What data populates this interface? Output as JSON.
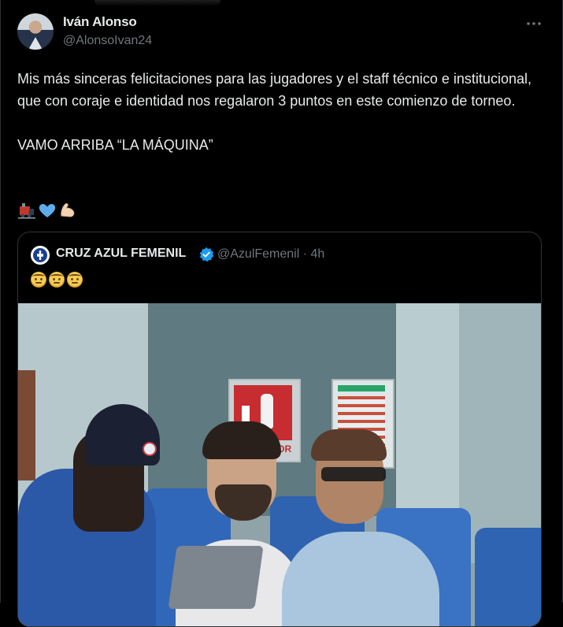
{
  "author": {
    "display_name": "Iván Alonso",
    "handle": "@AlonsoIvan24"
  },
  "tweet": {
    "text": "Mis más sinceras felicitaciones para las jugadores y el staff técnico e institucional, que con coraje e identidad nos regalaron 3 puntos en este comienzo de torneo.\n\nVAMO ARRIBA “LA MÁQUINA”",
    "emojis": [
      "train-icon",
      "blue-heart-icon",
      "flexed-biceps-icon"
    ]
  },
  "quote": {
    "display_name": "CRUZ AZUL FEMENIL",
    "handle_time": "@AzulFemenil · 4h",
    "emojis": [
      "saluting-face-icon",
      "saluting-face-icon",
      "saluting-face-icon"
    ],
    "photo_sign_text": "TOR"
  },
  "colors": {
    "background": "#000000",
    "text": "#e7e9ea",
    "secondary": "#71767b",
    "border": "#2f3336",
    "verified": "#1d9bf0"
  }
}
